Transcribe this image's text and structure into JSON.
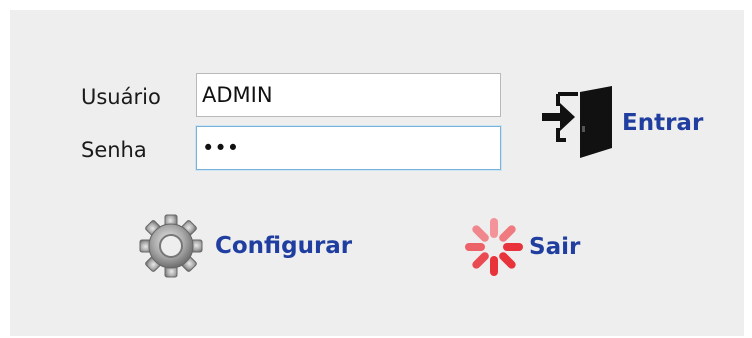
{
  "login": {
    "username_label": "Usuário",
    "username_value": "ADMIN",
    "password_label": "Senha",
    "password_value": "abc"
  },
  "actions": {
    "enter_label": "Entrar",
    "enter_icon": "door-enter-icon",
    "configure_label": "Configurar",
    "configure_icon": "gear-icon",
    "exit_label": "Sair",
    "exit_icon": "spinner-icon"
  },
  "colors": {
    "panel_background": "#eeeeee",
    "action_text": "#1f3ea0",
    "focus_border": "#7ab3da",
    "exit_icon": "#e8333b"
  }
}
